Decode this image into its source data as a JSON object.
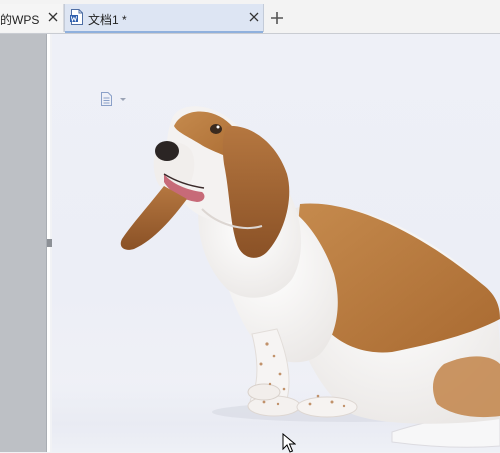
{
  "tabs": [
    {
      "label": "的WPS",
      "close_label": "×"
    },
    {
      "label": "文档1 *",
      "close_label": "×"
    }
  ],
  "new_tab_label": "+",
  "document": {
    "image": "basset-hound-photo",
    "menu_icon": "document-options-icon"
  },
  "colors": {
    "active_tab": "#dde5f3",
    "tab_bar": "#f3f3f3",
    "gutter": "#bdc0c5",
    "page_background": "#eceef6",
    "dog_coat": "#b8773c"
  }
}
